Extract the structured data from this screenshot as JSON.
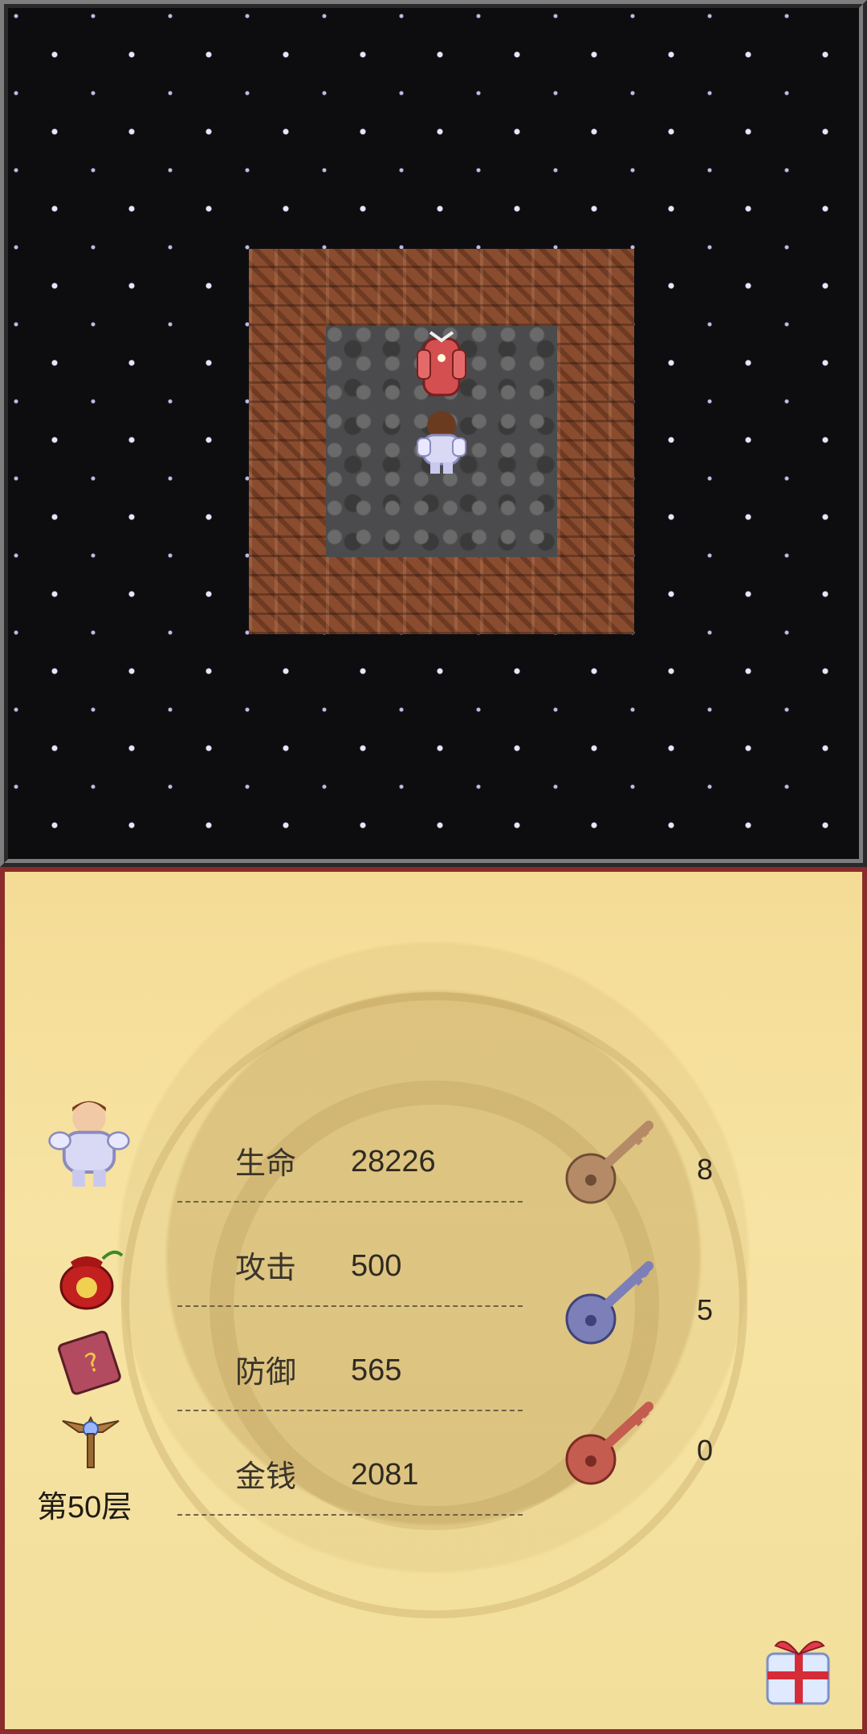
{
  "map": {
    "floor_number": 50
  },
  "status": {
    "hp_label": "生命",
    "hp_value": "28226",
    "attack_label": "攻击",
    "attack_value": "500",
    "defense_label": "防御",
    "defense_value": "565",
    "gold_label": "金钱",
    "gold_value": "2081"
  },
  "inventory": {
    "floor_text": "第50层",
    "keys": [
      {
        "name": "yellow-key",
        "count": "8",
        "color": "#b58a67"
      },
      {
        "name": "blue-key",
        "count": "5",
        "color": "#7c7fb8"
      },
      {
        "name": "red-key",
        "count": "0",
        "color": "#c45c4f"
      }
    ]
  },
  "colors": {
    "panel_bg": "#f4dc95",
    "board_bg": "#0d0d0f",
    "room_wall": "#8a4c2f",
    "room_floor": "#4b4b4d"
  },
  "icons": {
    "hero": "hero-portrait-icon",
    "lucky_bag": "lucky-bag-icon",
    "monster_manual": "monster-manual-icon",
    "fly_wand": "fly-wand-icon",
    "gift": "gift-icon"
  }
}
